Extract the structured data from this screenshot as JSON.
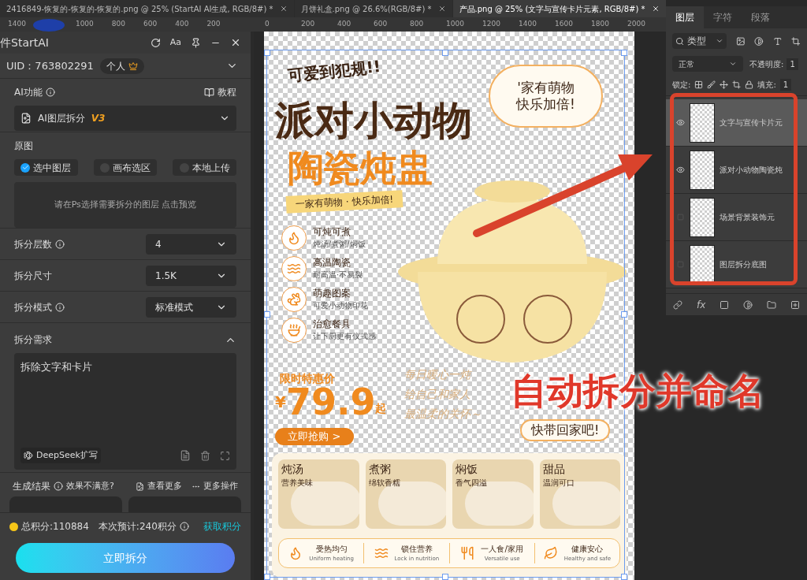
{
  "document_tabs": [
    {
      "label": "2416849-恢复的-恢复的-恢复的.png @ 25% (StartAI AI生成, RGB/8#) *",
      "selected": false
    },
    {
      "label": "月饼礼盒.png @ 26.6%(RGB/8#) *",
      "selected": false
    },
    {
      "label": "产品.png @ 25% (文字与宣传卡片元素, RGB/8#) *",
      "selected": true
    }
  ],
  "ruler": {
    "left_labels": [
      "1400",
      "1000",
      "800",
      "600",
      "400",
      "200"
    ],
    "canvas_labels": [
      "0",
      "200",
      "400",
      "600",
      "800",
      "1000",
      "1200",
      "1400",
      "1600",
      "1800",
      "2000"
    ]
  },
  "plugin": {
    "title": "件StartAI",
    "font_button": "Aa",
    "uid": "UID：763802291",
    "plan_badge": "个人",
    "ai_function": {
      "label": "AI功能",
      "tutorial": "教程",
      "selected_function": "AI图层拆分",
      "version": "V3"
    },
    "source": {
      "label": "原图",
      "options": [
        {
          "label": "选中图层",
          "selected": true
        },
        {
          "label": "画布选区",
          "selected": false
        },
        {
          "label": "本地上传",
          "selected": false
        }
      ],
      "preview_hint": "请在Ps选择需要拆分的图层 点击预览"
    },
    "settings": [
      {
        "label": "拆分层数",
        "info": true,
        "value": "4"
      },
      {
        "label": "拆分尺寸",
        "info": false,
        "value": "1.5K"
      },
      {
        "label": "拆分模式",
        "info": true,
        "value": "标准模式"
      }
    ],
    "requirement": {
      "label": "拆分需求",
      "expanded": true,
      "value": "拆除文字和卡片",
      "expand_button": "DeepSeek扩写"
    },
    "results": {
      "label": "生成结果",
      "hint": "效果不满意?",
      "view_more": "查看更多",
      "more_actions": "更多操作"
    },
    "footer": {
      "total_points": "总积分:110884",
      "estimate": "本次预计:240积分",
      "get_points": "获取积分",
      "action_button": "立即拆分"
    }
  },
  "poster": {
    "tagline": "可爱到犯规!!",
    "title": "派对小动物",
    "subtitle": "陶瓷炖盅",
    "ribbon": "一家有萌物 · 快乐加倍!",
    "bubble": [
      "'家有萌物",
      "快乐加倍!"
    ],
    "features": [
      {
        "title": "可炖可煮",
        "desc": "炖汤/煮粥/焖饭"
      },
      {
        "title": "高温陶瓷",
        "desc": "耐高温·不易裂"
      },
      {
        "title": "萌趣图案",
        "desc": "可爱小动物印花"
      },
      {
        "title": "治愈餐具",
        "desc": "让下厨更有仪式感"
      }
    ],
    "price_label": "限时特惠价",
    "currency": "¥",
    "price": "79.9",
    "price_suffix": "起",
    "buy_button": "立即抢购 >",
    "handwriting": [
      "每日暖心一炖",
      "给自己和家人",
      "最温柔的关怀～"
    ],
    "closing": "快带回家吧!",
    "dishes": [
      {
        "title": "炖汤",
        "desc": "营养美味"
      },
      {
        "title": "煮粥",
        "desc": "绵软香糯"
      },
      {
        "title": "焖饭",
        "desc": "香气四溢"
      },
      {
        "title": "甜品",
        "desc": "温润可口"
      }
    ],
    "benefits": [
      {
        "title": "受热均匀",
        "en": "Uniform heating"
      },
      {
        "title": "锁住营养",
        "en": "Lock in nutrition"
      },
      {
        "title": "一人食/家用",
        "en": "Versatile use"
      },
      {
        "title": "健康安心",
        "en": "Healthy and safe"
      }
    ]
  },
  "layers_panel": {
    "tabs": [
      {
        "label": "图层",
        "selected": true
      },
      {
        "label": "字符",
        "selected": false
      },
      {
        "label": "段落",
        "selected": false
      }
    ],
    "filter": "类型",
    "blend_mode": "正常",
    "opacity_label": "不透明度:",
    "opacity_value": "1",
    "lock_label": "锁定:",
    "fill_label": "填充:",
    "fill_value": "1",
    "fx_label": "fx",
    "layers": [
      {
        "name": "文字与宣传卡片元",
        "visible": true,
        "selected": true
      },
      {
        "name": "派对小动物陶瓷炖",
        "visible": true,
        "selected": false
      },
      {
        "name": "场景背景装饰元",
        "visible": false,
        "selected": false
      },
      {
        "name": "图层拆分底图",
        "visible": false,
        "selected": false
      }
    ]
  },
  "annotation": {
    "caption": "自动拆分并命名"
  }
}
